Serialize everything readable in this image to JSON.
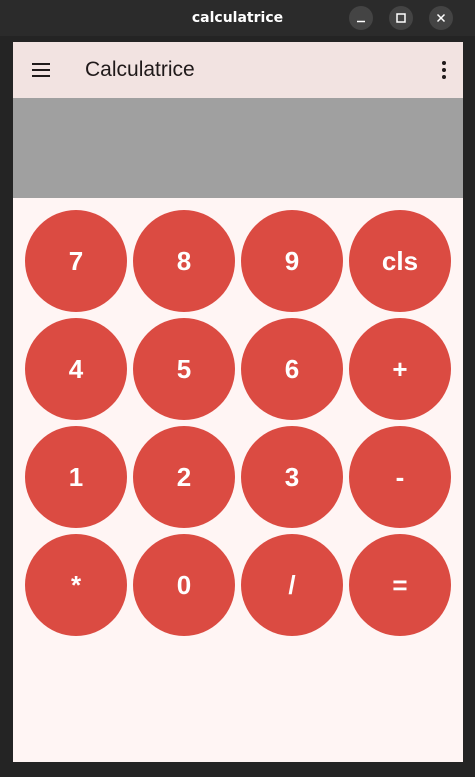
{
  "window": {
    "title": "calculatrice"
  },
  "appbar": {
    "title": "Calculatrice",
    "background": "#f2e3e1"
  },
  "display": {
    "value": "",
    "background": "#a0a0a0"
  },
  "keypad": {
    "button_color": "#db4b42",
    "keys": [
      "7",
      "8",
      "9",
      "cls",
      "4",
      "5",
      "6",
      "+",
      "1",
      "2",
      "3",
      "-",
      "*",
      "0",
      "/",
      "="
    ]
  },
  "icons": {
    "menu": "menu-icon",
    "more": "more-vert-icon",
    "minimize": "minimize-icon",
    "maximize": "maximize-icon",
    "close": "close-icon"
  }
}
